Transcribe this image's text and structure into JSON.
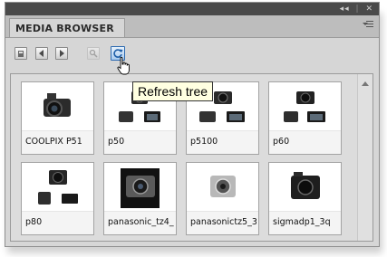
{
  "panel": {
    "title": "MEDIA BROWSER",
    "window_controls": [
      "◂◂",
      "✕"
    ]
  },
  "toolbar": {
    "buttons": [
      {
        "name": "go-up",
        "icon": "folder-up-icon"
      },
      {
        "name": "back",
        "icon": "arrow-left-icon"
      },
      {
        "name": "forward",
        "icon": "arrow-right-icon"
      },
      {
        "name": "search",
        "icon": "magnifier-icon",
        "disabled": true
      },
      {
        "name": "refresh-tree",
        "icon": "refresh-icon",
        "active": true
      }
    ],
    "tooltip": "Refresh tree"
  },
  "thumbnails": [
    {
      "label": "COOLPIX P51"
    },
    {
      "label": "p50"
    },
    {
      "label": "p5100"
    },
    {
      "label": "p60"
    },
    {
      "label": "p80"
    },
    {
      "label": "panasonic_tz4_"
    },
    {
      "label": "panasonictz5_3"
    },
    {
      "label": "sigmadp1_3q"
    }
  ],
  "colors": {
    "tooltip_bg": "#ffffe1",
    "panel_bg": "#d6d6d6",
    "titlebar": "#4a4a4a",
    "active_button": "#2d6ab0"
  }
}
